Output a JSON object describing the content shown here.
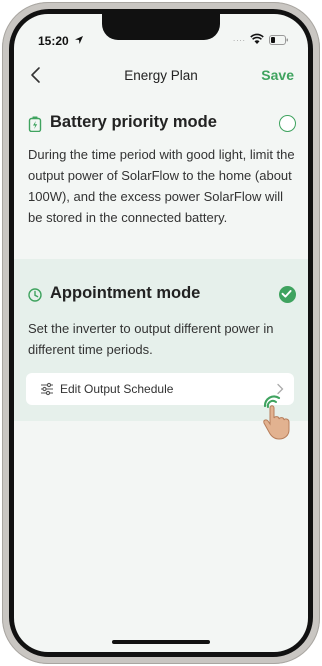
{
  "status_bar": {
    "time": "15:20",
    "signal": "....",
    "icons": [
      "location-icon",
      "wifi-icon",
      "battery-icon"
    ]
  },
  "header": {
    "title": "Energy Plan",
    "save_label": "Save",
    "back_icon": "chevron-left-icon"
  },
  "modes": [
    {
      "title": "Battery priority mode",
      "icon": "battery-icon",
      "selected": false,
      "description": "During the time period with good light, limit the output power of SolarFlow to the home (about 100W), and the excess power SolarFlow will be stored in the connected battery."
    },
    {
      "title": "Appointment mode",
      "icon": "clock-icon",
      "selected": true,
      "description": "Set the inverter to output different power in different time periods.",
      "action": {
        "label": "Edit Output Schedule",
        "icon": "sliders-icon"
      }
    }
  ],
  "colors": {
    "accent": "#3fa35f",
    "selected_card_bg": "#e6f0eb",
    "screen_bg": "#f3f6f4"
  }
}
